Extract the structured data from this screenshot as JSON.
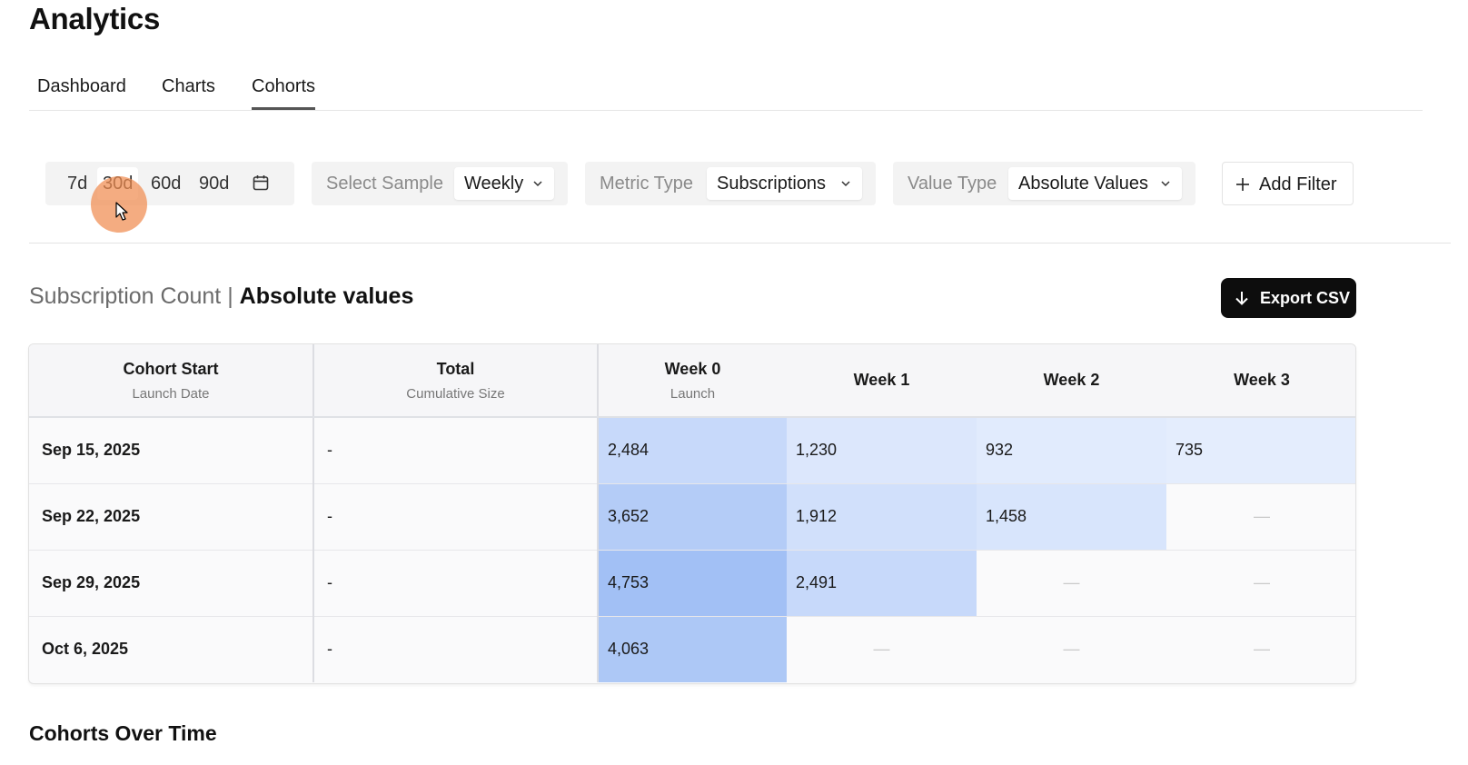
{
  "page": {
    "title": "Analytics"
  },
  "tabs": [
    {
      "label": "Dashboard",
      "active": false
    },
    {
      "label": "Charts",
      "active": false
    },
    {
      "label": "Cohorts",
      "active": true
    }
  ],
  "filters": {
    "ranges": [
      {
        "label": "7d",
        "active": false
      },
      {
        "label": "30d",
        "active": true
      },
      {
        "label": "60d",
        "active": false
      },
      {
        "label": "90d",
        "active": false
      }
    ],
    "calendar_icon": "calendar-icon",
    "sample": {
      "label": "Select Sample",
      "value": "Weekly"
    },
    "metric": {
      "label": "Metric Type",
      "value": "Subscriptions"
    },
    "value_type": {
      "label": "Value Type",
      "value": "Absolute Values"
    },
    "add_filter": "Add Filter"
  },
  "section": {
    "title_light": "Subscription Count",
    "separator": "|",
    "title_bold": "Absolute values",
    "export_label": "Export CSV"
  },
  "table": {
    "headers": [
      {
        "title": "Cohort Start",
        "sub": "Launch Date"
      },
      {
        "title": "Total",
        "sub": "Cumulative Size"
      },
      {
        "title": "Week 0",
        "sub": "Launch"
      },
      {
        "title": "Week 1",
        "sub": ""
      },
      {
        "title": "Week 2",
        "sub": ""
      },
      {
        "title": "Week 3",
        "sub": ""
      }
    ],
    "rows": [
      {
        "date": "Sep 15, 2025",
        "total": "-",
        "weeks": [
          "2,484",
          "1,230",
          "932",
          "735"
        ]
      },
      {
        "date": "Sep 22, 2025",
        "total": "-",
        "weeks": [
          "3,652",
          "1,912",
          "1,458",
          null
        ]
      },
      {
        "date": "Sep 29, 2025",
        "total": "-",
        "weeks": [
          "4,753",
          "2,491",
          null,
          null
        ]
      },
      {
        "date": "Oct 6, 2025",
        "total": "-",
        "weeks": [
          "4,063",
          null,
          null,
          null
        ]
      }
    ],
    "heat_colors": {
      "low": "#e4edfd",
      "high": "#a2c0f5"
    }
  },
  "section2": {
    "title": "Cohorts Over Time"
  }
}
